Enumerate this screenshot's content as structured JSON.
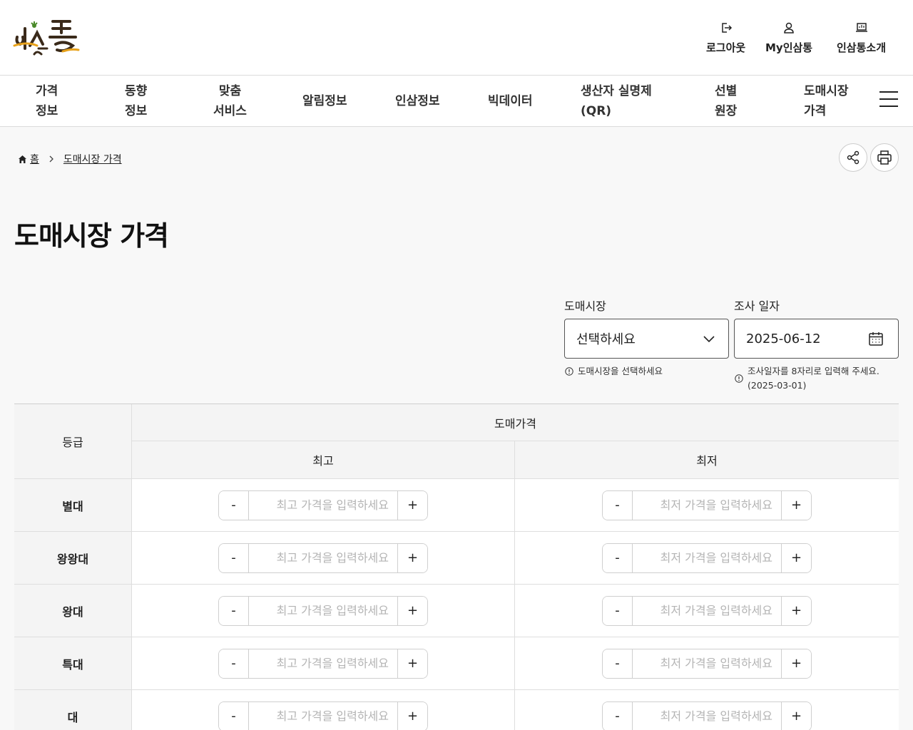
{
  "brand": {
    "logo_text": "인삼통"
  },
  "header": {
    "util_links": [
      {
        "label": "로그아웃",
        "icon": "logout-icon"
      },
      {
        "label": "My인삼통",
        "icon": "user-icon"
      },
      {
        "label": "인삼통소개",
        "icon": "laptop-icon"
      }
    ]
  },
  "gnb": {
    "items": [
      {
        "line1": "가격",
        "line2": "정보"
      },
      {
        "line1": "동향",
        "line2": "정보"
      },
      {
        "line1": "맞춤",
        "line2": "서비스"
      },
      {
        "line1": "알림정보",
        "line2": ""
      },
      {
        "line1": "인삼정보",
        "line2": ""
      },
      {
        "line1": "빅데이터",
        "line2": ""
      },
      {
        "line1": "생산자 실명제",
        "line2": "(QR)"
      },
      {
        "line1": "선별",
        "line2": "원장"
      },
      {
        "line1": "도매시장",
        "line2": "가격"
      }
    ]
  },
  "breadcrumb": {
    "home": "홈",
    "current": "도매시장 가격"
  },
  "page": {
    "title": "도매시장 가격"
  },
  "filters": {
    "market": {
      "label": "도매시장",
      "value": "선택하세요",
      "hint": "도매시장을 선택하세요"
    },
    "date": {
      "label": "조사 일자",
      "value": "2025-06-12",
      "hint_line1": "조사일자를 8자리로 입력해 주세요.",
      "hint_line2": "(2025-03-01)"
    }
  },
  "table": {
    "grade_header": "등급",
    "price_header": "도매가격",
    "max_header": "최고",
    "min_header": "최저",
    "max_placeholder": "최고 가격을 입력하세요",
    "min_placeholder": "최저 가격을 입력하세요",
    "minus_label": "-",
    "plus_label": "+",
    "rows": [
      {
        "grade": "별대"
      },
      {
        "grade": "왕왕대"
      },
      {
        "grade": "왕대"
      },
      {
        "grade": "특대"
      },
      {
        "grade": "대"
      }
    ]
  }
}
